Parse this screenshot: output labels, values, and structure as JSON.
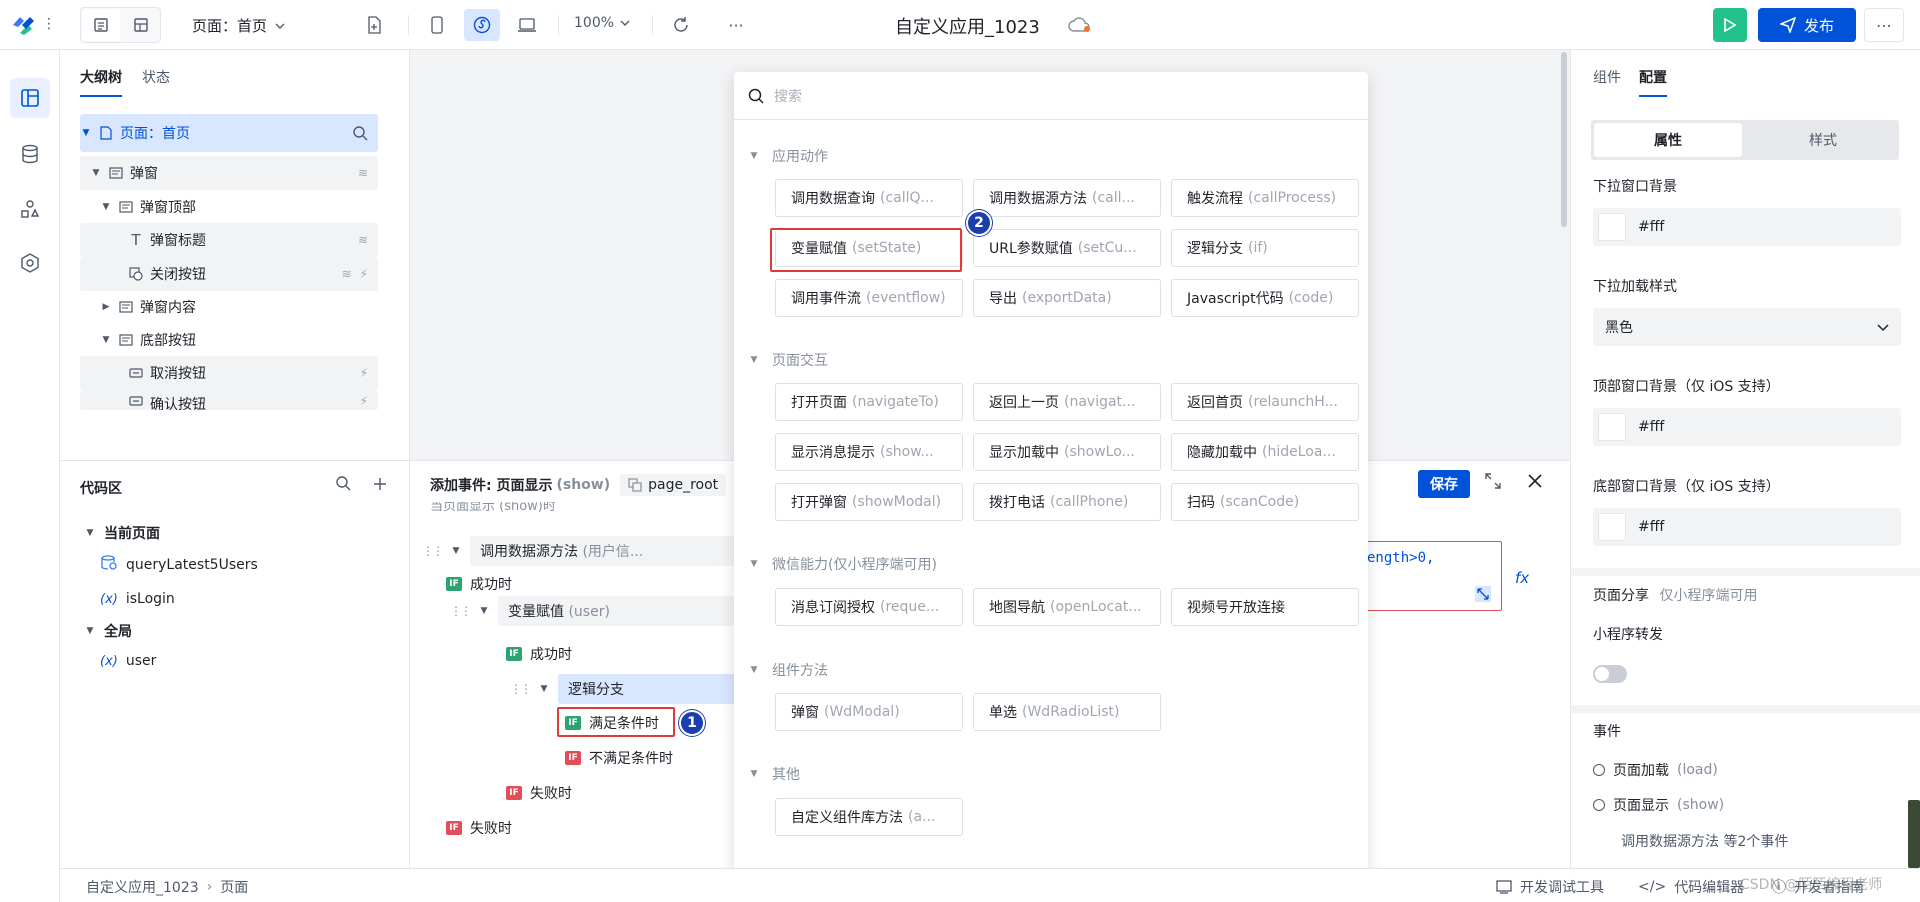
{
  "header": {
    "page_select": "页面：首页",
    "zoom": "100%",
    "app_title": "自定义应用_1023",
    "publish_label": "发布",
    "more": "⋯"
  },
  "outline": {
    "tabs": [
      "大纲树",
      "状态"
    ],
    "tree": [
      {
        "label": "页面：首页"
      },
      {
        "label": "弹窗"
      },
      {
        "label": "弹窗顶部"
      },
      {
        "label": "弹窗标题"
      },
      {
        "label": "关闭按钮"
      },
      {
        "label": "弹窗内容"
      },
      {
        "label": "底部按钮"
      },
      {
        "label": "取消按钮"
      },
      {
        "label": "确认按钮"
      }
    ]
  },
  "code_area": {
    "title": "代码区",
    "current_page": "当前页面",
    "items": [
      "queryLatest5Users",
      "isLogin"
    ],
    "global": "全局",
    "global_items": [
      "user"
    ]
  },
  "event_editor": {
    "title": "添加事件: 页面显示",
    "title_code": "(show)",
    "root_chip": "page_root",
    "save_label": "保存",
    "cut_line": "当页面显示 (show)时",
    "flow": [
      {
        "label": "调用数据源方法",
        "sub": "(用户信..."
      },
      {
        "label": "成功时"
      },
      {
        "label": "变量赋值",
        "sub": "(user)"
      },
      {
        "label": "成功时"
      },
      {
        "label": "逻辑分支"
      },
      {
        "label": "满足条件时"
      },
      {
        "label": "不满足条件时"
      },
      {
        "label": "失败时"
      },
      {
        "label": "失败时"
      }
    ],
    "code_snippet": "ength>0,",
    "fx": "fx"
  },
  "action_menu": {
    "search_placeholder": "搜索",
    "groups": [
      {
        "title": "应用动作",
        "items": [
          {
            "label": "调用数据查询",
            "code": "(callQ..."
          },
          {
            "label": "调用数据源方法",
            "code": "(call..."
          },
          {
            "label": "触发流程",
            "code": "(callProcess)"
          },
          {
            "label": "变量赋值",
            "code": "(setState)"
          },
          {
            "label": "URL参数赋值",
            "code": "(setCu..."
          },
          {
            "label": "逻辑分支",
            "code": "(if)"
          },
          {
            "label": "调用事件流",
            "code": "(eventflow)"
          },
          {
            "label": "导出",
            "code": "(exportData)"
          },
          {
            "label": "Javascript代码",
            "code": "(code)"
          }
        ]
      },
      {
        "title": "页面交互",
        "items": [
          {
            "label": "打开页面",
            "code": "(navigateTo)"
          },
          {
            "label": "返回上一页",
            "code": "(navigat..."
          },
          {
            "label": "返回首页",
            "code": "(relaunchH..."
          },
          {
            "label": "显示消息提示",
            "code": "(show..."
          },
          {
            "label": "显示加载中",
            "code": "(showLo..."
          },
          {
            "label": "隐藏加载中",
            "code": "(hideLoa..."
          },
          {
            "label": "打开弹窗",
            "code": "(showModal)"
          },
          {
            "label": "拨打电话",
            "code": "(callPhone)"
          },
          {
            "label": "扫码",
            "code": "(scanCode)"
          }
        ]
      },
      {
        "title": "微信能力(仅小程序端可用)",
        "items": [
          {
            "label": "消息订阅授权",
            "code": "(reque..."
          },
          {
            "label": "地图导航",
            "code": "(openLocat..."
          },
          {
            "label": "视频号开放连接",
            "code": ""
          }
        ]
      },
      {
        "title": "组件方法",
        "items": [
          {
            "label": "弹窗",
            "code": "(WdModal)"
          },
          {
            "label": "单选",
            "code": "(WdRadioList)"
          }
        ]
      },
      {
        "title": "其他",
        "items": [
          {
            "label": "自定义组件库方法",
            "code": "(a..."
          }
        ]
      }
    ]
  },
  "badges": [
    "1",
    "2"
  ],
  "right_panel": {
    "tabs": [
      "组件",
      "配置"
    ],
    "seg": [
      "属性",
      "样式"
    ],
    "props": [
      {
        "label": "下拉窗口背景",
        "value": "#fff"
      },
      {
        "label": "下拉加载样式",
        "value": "黑色"
      },
      {
        "label": "顶部窗口背景（仅 iOS 支持）",
        "value": "#fff"
      },
      {
        "label": "底部窗口背景（仅 iOS 支持）",
        "value": "#fff"
      }
    ],
    "share_label": "页面分享",
    "share_note": "仅小程序端可用",
    "forward_label": "小程序转发",
    "events_title": "事件",
    "events": [
      {
        "label": "页面加载",
        "code": "(load)"
      },
      {
        "label": "页面显示",
        "code": "(show)"
      }
    ],
    "event_summary": "调用数据源方法 等2个事件"
  },
  "statusbar": {
    "breadcrumb": [
      "自定义应用_1023",
      "页面"
    ],
    "devtools": "开发调试工具",
    "code_editor": "代码编辑器",
    "dev_guide": "开发者指南"
  },
  "watermark": "CSDN @陌陌编程老师",
  "colors": {
    "primary": "#0052d9",
    "success": "#2ba471",
    "danger": "#e34d59",
    "highlight_red": "#e03b3b"
  }
}
